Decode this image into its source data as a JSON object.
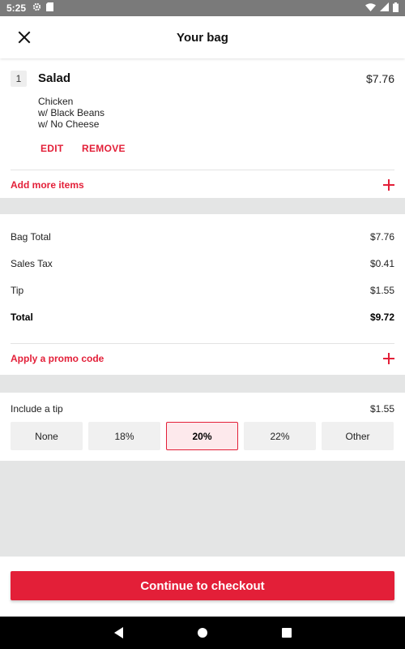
{
  "status_bar": {
    "time": "5:25",
    "icons": [
      "gear-icon",
      "sd-card-icon",
      "wifi-icon",
      "signal-icon",
      "battery-icon"
    ]
  },
  "header": {
    "title": "Your bag",
    "close_icon": "close-icon"
  },
  "bag": {
    "items": [
      {
        "quantity": "1",
        "name": "Salad",
        "price": "$7.76",
        "modifiers": [
          "Chicken",
          "w/ Black Beans",
          "w/ No Cheese"
        ],
        "edit_label": "EDIT",
        "remove_label": "REMOVE"
      }
    ],
    "add_more_label": "Add more items"
  },
  "totals": {
    "bag_total_label": "Bag Total",
    "bag_total_value": "$7.76",
    "sales_tax_label": "Sales Tax",
    "sales_tax_value": "$0.41",
    "tip_label": "Tip",
    "tip_value": "$1.55",
    "total_label": "Total",
    "total_value": "$9.72",
    "promo_label": "Apply a promo code"
  },
  "tip": {
    "label": "Include a tip",
    "amount": "$1.55",
    "options": [
      "None",
      "18%",
      "20%",
      "22%",
      "Other"
    ],
    "selected": "20%"
  },
  "checkout": {
    "label": "Continue to checkout"
  },
  "colors": {
    "accent": "#e31f38",
    "selected_tip_bg": "#fde9ec",
    "page_bg": "#e4e5e5"
  }
}
